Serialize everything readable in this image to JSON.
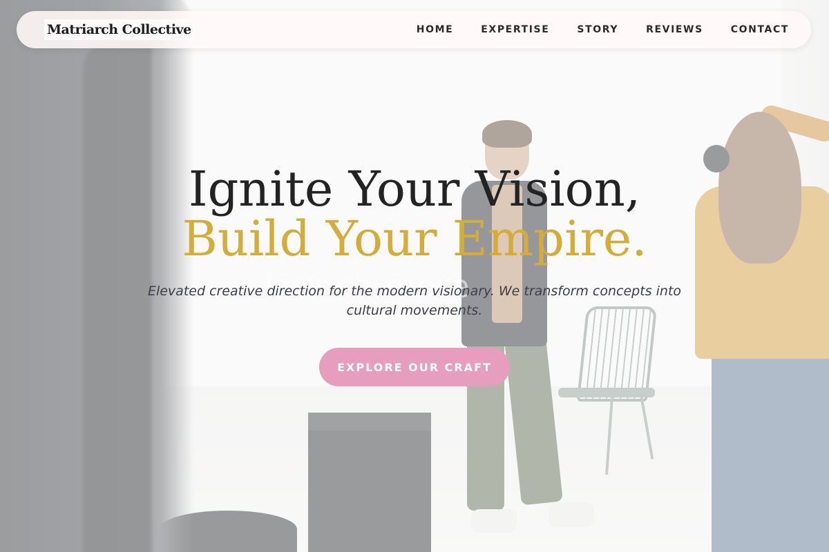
{
  "brand": {
    "name": "Matriarch Collective"
  },
  "nav": {
    "items": [
      {
        "label": "HOME"
      },
      {
        "label": "EXPERTISE"
      },
      {
        "label": "STORY"
      },
      {
        "label": "REVIEWS"
      },
      {
        "label": "CONTACT"
      }
    ]
  },
  "hero": {
    "headline_line1": "Ignite Your Vision,",
    "headline_line2": "Build Your Empire.",
    "subtitle": "Elevated creative direction for the modern visionary. We transform concepts into cultural movements.",
    "cta_label": "EXPLORE OUR CRAFT",
    "watermark": "launch more"
  },
  "colors": {
    "accent_gold": "#d3ac3a",
    "cta_pink": "#e79dbd",
    "text_dark": "#232323"
  }
}
